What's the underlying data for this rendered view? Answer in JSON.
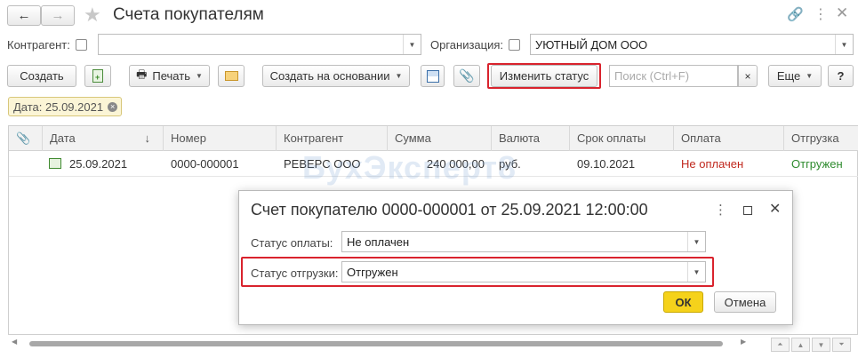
{
  "window": {
    "title": "Счета покупателям"
  },
  "filters": {
    "contractor_label": "Контрагент:",
    "contractor_value": "",
    "organization_label": "Организация:",
    "organization_value": "УЮТНЫЙ ДОМ ООО"
  },
  "toolbar": {
    "create_label": "Создать",
    "print_label": "Печать",
    "create_based_label": "Создать на основании",
    "change_status_label": "Изменить статус",
    "search_placeholder": "Поиск (Ctrl+F)",
    "search_clear": "×",
    "more_label": "Еще",
    "help_label": "?"
  },
  "filter_chip": {
    "label": "Дата: 25.09.2021"
  },
  "table": {
    "columns": [
      "Дата",
      "Номер",
      "Контрагент",
      "Сумма",
      "Валюта",
      "Срок оплаты",
      "Оплата",
      "Отгрузка"
    ],
    "rows": [
      {
        "date": "25.09.2021",
        "number": "0000-000001",
        "contractor": "РЕВЕРС ООО",
        "amount": "240 000,00",
        "currency": "руб.",
        "due_date": "09.10.2021",
        "payment": "Не оплачен",
        "shipment": "Отгружен"
      }
    ]
  },
  "watermark": "БухЭксперт8",
  "dialog": {
    "title": "Счет покупателю 0000-000001 от 25.09.2021 12:00:00",
    "payment_status_label": "Статус оплаты:",
    "payment_status_value": "Не оплачен",
    "shipment_status_label": "Статус отгрузки:",
    "shipment_status_value": "Отгружен",
    "ok_label": "ОК",
    "cancel_label": "Отмена"
  },
  "colors": {
    "highlight_red": "#d9232d",
    "ok_yellow": "#f5d21b",
    "payment_red": "#c0281e",
    "shipment_green": "#2e8b2e"
  }
}
